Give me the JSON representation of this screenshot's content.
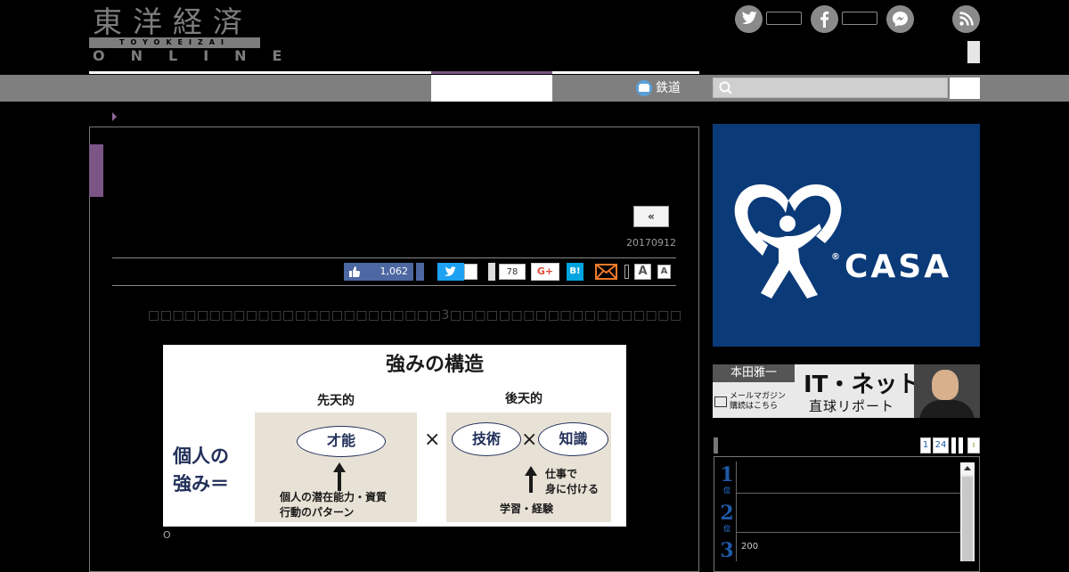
{
  "logo": {
    "main": "東洋経済",
    "sub": "TOYOKEIZAI",
    "online": "ONLINE"
  },
  "nav": {
    "rail_label": "鉄道",
    "search_placeholder": ""
  },
  "article": {
    "prev_label": "«",
    "date": "20170912",
    "share": {
      "facebook_count": "1,062",
      "hatena_count": "78",
      "gplus_label": "G+",
      "hatena_label": "B!",
      "font_large": "A",
      "font_small": "A"
    },
    "lead_text": "□□□□□□□□□□□□□□□□□□□□□□□□3□□□□□□□□□□□□□□□□□□□",
    "figure": {
      "title": "強みの構造",
      "innate": "先天的",
      "acquired": "後天的",
      "subject_line1": "個人の",
      "subject_line2": "強み＝",
      "talent": "才能",
      "times1": "×",
      "times2": "×",
      "skill": "技術",
      "knowledge": "知識",
      "talent_source_line1": "個人の潜在能力・資質",
      "talent_source_line2": "行動のパターン",
      "acquire_line1": "仕事で",
      "acquire_line2": "身に付ける",
      "learning": "学習・経験"
    },
    "caption": "O"
  },
  "sidebar": {
    "ad_casa_text": "CASA",
    "ad_casa_reg": "®",
    "ad_honda": {
      "name": "本田雅一",
      "title": "IT・ネット",
      "subtitle": "直球リポート",
      "mail_line1": "メールマガジン",
      "mail_line2": "購読はこちら"
    },
    "ranking": {
      "tabs": [
        "1",
        "24"
      ],
      "items": [
        {
          "num": "1",
          "suffix": "位",
          "text": ""
        },
        {
          "num": "2",
          "suffix": "位",
          "text": ""
        },
        {
          "num": "3",
          "suffix": "",
          "text": "200"
        }
      ]
    }
  },
  "colors": {
    "accent_purple": "#7a5585",
    "nav_gray": "#7f7f7f",
    "casa_blue": "#0b3a78",
    "facebook": "#4c67a1",
    "twitter": "#1da1f2",
    "hatena": "#00a4de",
    "rank_blue": "#1e5aa8"
  }
}
